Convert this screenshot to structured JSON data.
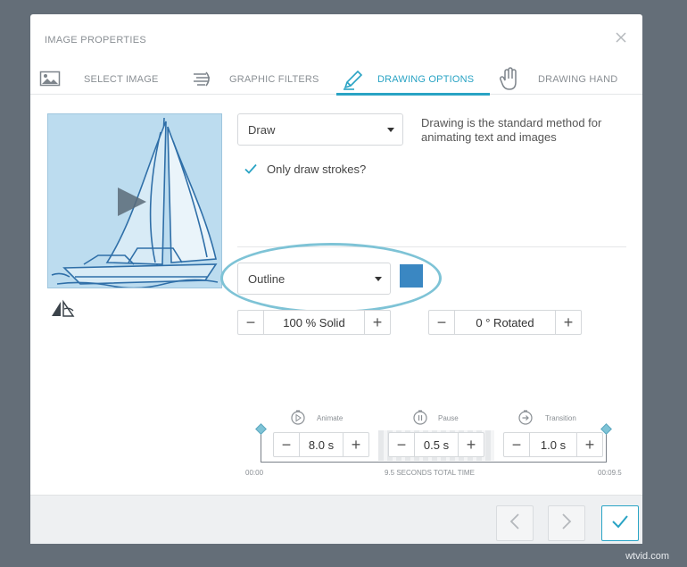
{
  "dialog": {
    "title": "IMAGE PROPERTIES"
  },
  "tabs": [
    {
      "label": "SELECT IMAGE",
      "icon": "image-icon",
      "active": false
    },
    {
      "label": "GRAPHIC FILTERS",
      "icon": "filter-icon",
      "active": false
    },
    {
      "label": "DRAWING OPTIONS",
      "icon": "pencil-icon",
      "active": true
    },
    {
      "label": "DRAWING HAND",
      "icon": "hand-icon",
      "active": false
    }
  ],
  "draw_mode": {
    "selected": "Draw",
    "description": "Drawing is the standard method for animating text and images"
  },
  "only_strokes": {
    "label": "Only draw strokes?",
    "checked": true
  },
  "fill": {
    "selected": "Outline",
    "color": "#3a87c2"
  },
  "opacity_stepper": {
    "minus": "−",
    "value": "100 % Solid",
    "plus": "+"
  },
  "rotation_stepper": {
    "minus": "−",
    "value": "0 ° Rotated",
    "plus": "+"
  },
  "timeline": {
    "animate": {
      "label": "Animate",
      "value": "8.0 s"
    },
    "pause": {
      "label": "Pause",
      "value": "0.5 s"
    },
    "transition": {
      "label": "Transition",
      "value": "1.0 s"
    },
    "start": "00:00",
    "total": "9.5 SECONDS TOTAL TIME",
    "end": "00:09.5"
  },
  "footer": {
    "prev_icon": "chevron-left-icon",
    "next_icon": "chevron-right-icon",
    "confirm_icon": "check-icon"
  },
  "watermark": "wtvid.com",
  "colors": {
    "accent": "#29a3c4",
    "highlight": "#7ec3d6"
  }
}
